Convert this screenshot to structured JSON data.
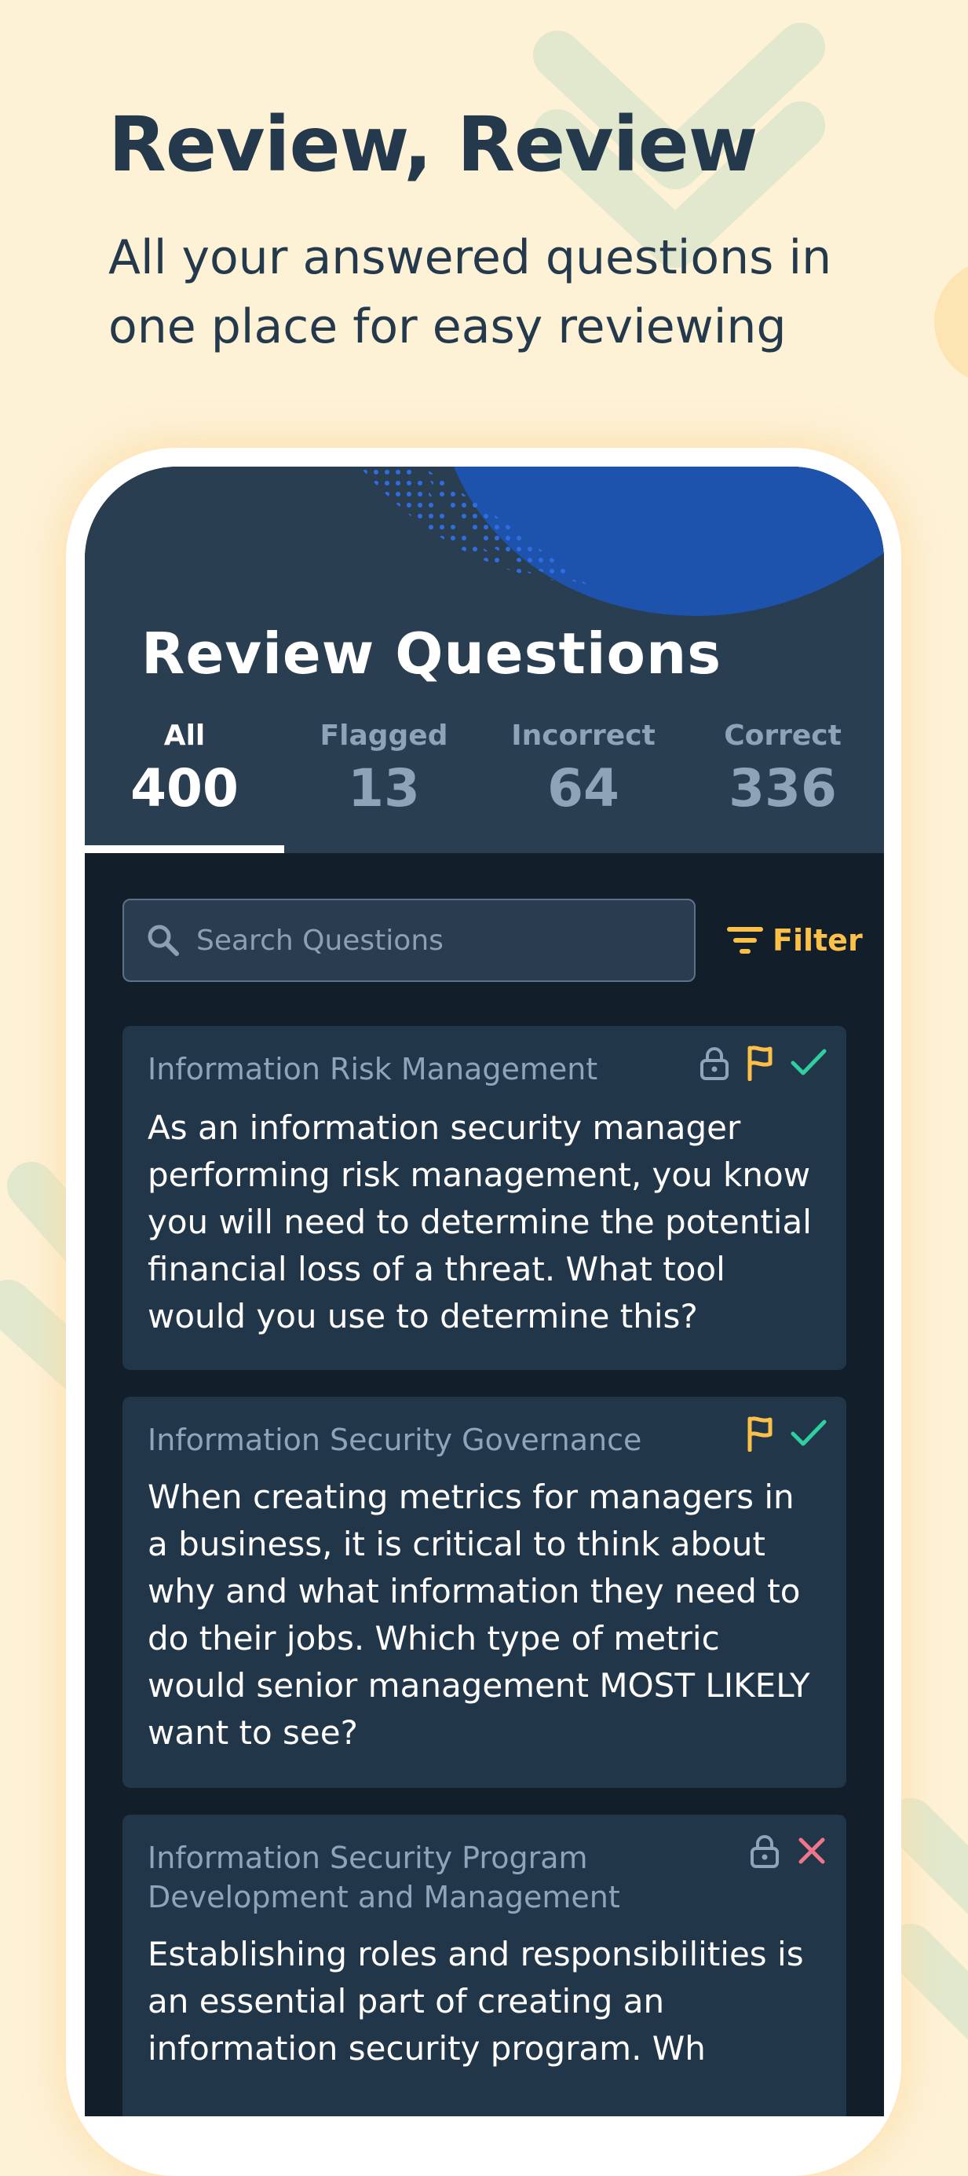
{
  "hero": {
    "title": "Review, Review",
    "subtitle": "All your answered questions in one place for easy reviewing"
  },
  "screen": {
    "title": "Review Questions",
    "tabs": [
      {
        "label": "All",
        "count": "400",
        "active": true
      },
      {
        "label": "Flagged",
        "count": "13",
        "active": false
      },
      {
        "label": "Incorrect",
        "count": "64",
        "active": false
      },
      {
        "label": "Correct",
        "count": "336",
        "active": false
      }
    ],
    "search": {
      "placeholder": "Search Questions",
      "value": ""
    },
    "filter_label": "Filter",
    "questions": [
      {
        "category": "Information Risk Management",
        "text": "As an information security manager performing risk management, you know you will need to determine the potential financial loss of a threat. What tool would you use to determine this?",
        "icons": [
          "lock-icon",
          "flag-icon",
          "check-icon"
        ]
      },
      {
        "category": "Information Security Governance",
        "text": "When creating metrics for managers in a business, it is critical to think about why and what information they need to do their jobs. Which type of metric would senior management MOST LIKELY want to see?",
        "icons": [
          "flag-icon",
          "check-icon"
        ]
      },
      {
        "category": "Information Security Program Development and Management",
        "text": "Establishing roles and responsibilities is an essential part of creating an information security program. Wh",
        "icons": [
          "lock-icon",
          "x-icon"
        ]
      }
    ]
  },
  "colors": {
    "page_background": "#fdf1d6",
    "hero_text": "#25394d",
    "header_background": "#2a3e52",
    "screen_background": "#121e29",
    "card_background": "#22364a",
    "accent_yellow": "#fcc048",
    "correct_green": "#2fd0a0",
    "incorrect_red": "#f0748a",
    "blue_blob": "#1d52ad"
  }
}
